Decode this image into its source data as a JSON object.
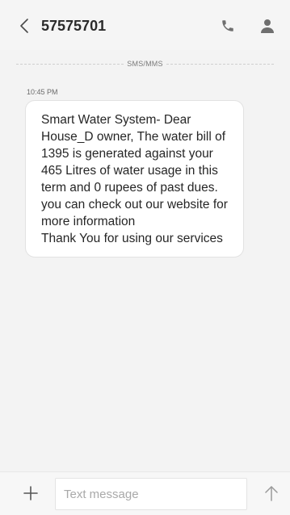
{
  "header": {
    "title": "57575701",
    "back_icon": "chevron-left-icon",
    "call_icon": "phone-icon",
    "contact_icon": "person-icon"
  },
  "thread": {
    "divider_label": "SMS/MMS",
    "messages": [
      {
        "time": "10:45 PM",
        "text": "Smart Water System- Dear House_D owner, The water bill of 1395 is generated against your 465 Litres of water usage in this term and 0 rupees of past dues. you can check out our website for more information\nThank You for using our services"
      }
    ]
  },
  "composer": {
    "placeholder": "Text message",
    "value": "",
    "add_icon": "plus-icon",
    "send_icon": "arrow-up-icon"
  },
  "colors": {
    "background": "#f3f3f3",
    "bubble": "#ffffff",
    "text": "#262626",
    "icon": "#8a8a8a"
  }
}
